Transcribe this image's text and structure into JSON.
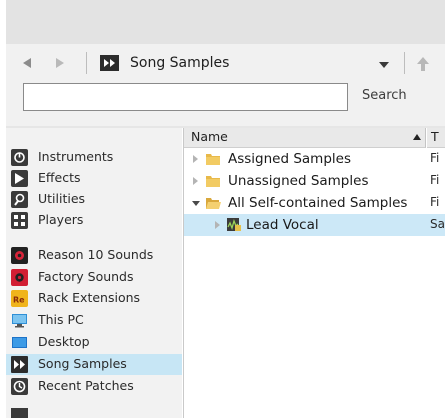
{
  "toolbar": {
    "location_label": "Song Samples",
    "search_placeholder": "",
    "search_value": "",
    "search_button": "Search"
  },
  "sidebar": {
    "items": [
      {
        "label": "Instruments",
        "icon": "instruments-icon"
      },
      {
        "label": "Effects",
        "icon": "effects-icon"
      },
      {
        "label": "Utilities",
        "icon": "utilities-icon"
      },
      {
        "label": "Players",
        "icon": "players-icon"
      },
      {
        "label": "Reason 10 Sounds",
        "icon": "reason-sounds-icon"
      },
      {
        "label": "Factory Sounds",
        "icon": "factory-sounds-icon"
      },
      {
        "label": "Rack Extensions",
        "icon": "rack-extensions-icon"
      },
      {
        "label": "This PC",
        "icon": "this-pc-icon"
      },
      {
        "label": "Desktop",
        "icon": "desktop-icon"
      },
      {
        "label": "Song Samples",
        "icon": "song-samples-icon",
        "selected": true
      },
      {
        "label": "Recent Patches",
        "icon": "recent-patches-icon"
      }
    ]
  },
  "file_list": {
    "column_name": "Name",
    "column_type": "T",
    "rows": [
      {
        "label": "Assigned Samples",
        "type": "Fi"
      },
      {
        "label": "Unassigned Samples",
        "type": "Fi"
      },
      {
        "label": "All Self-contained Samples",
        "type": "Fi"
      },
      {
        "label": "Lead Vocal",
        "type": "Sa",
        "selected": true
      }
    ]
  },
  "colors": {
    "selection": "#cce8f7",
    "folder": "#e8b94a",
    "toolbar_bg": "#f1f1f1"
  }
}
